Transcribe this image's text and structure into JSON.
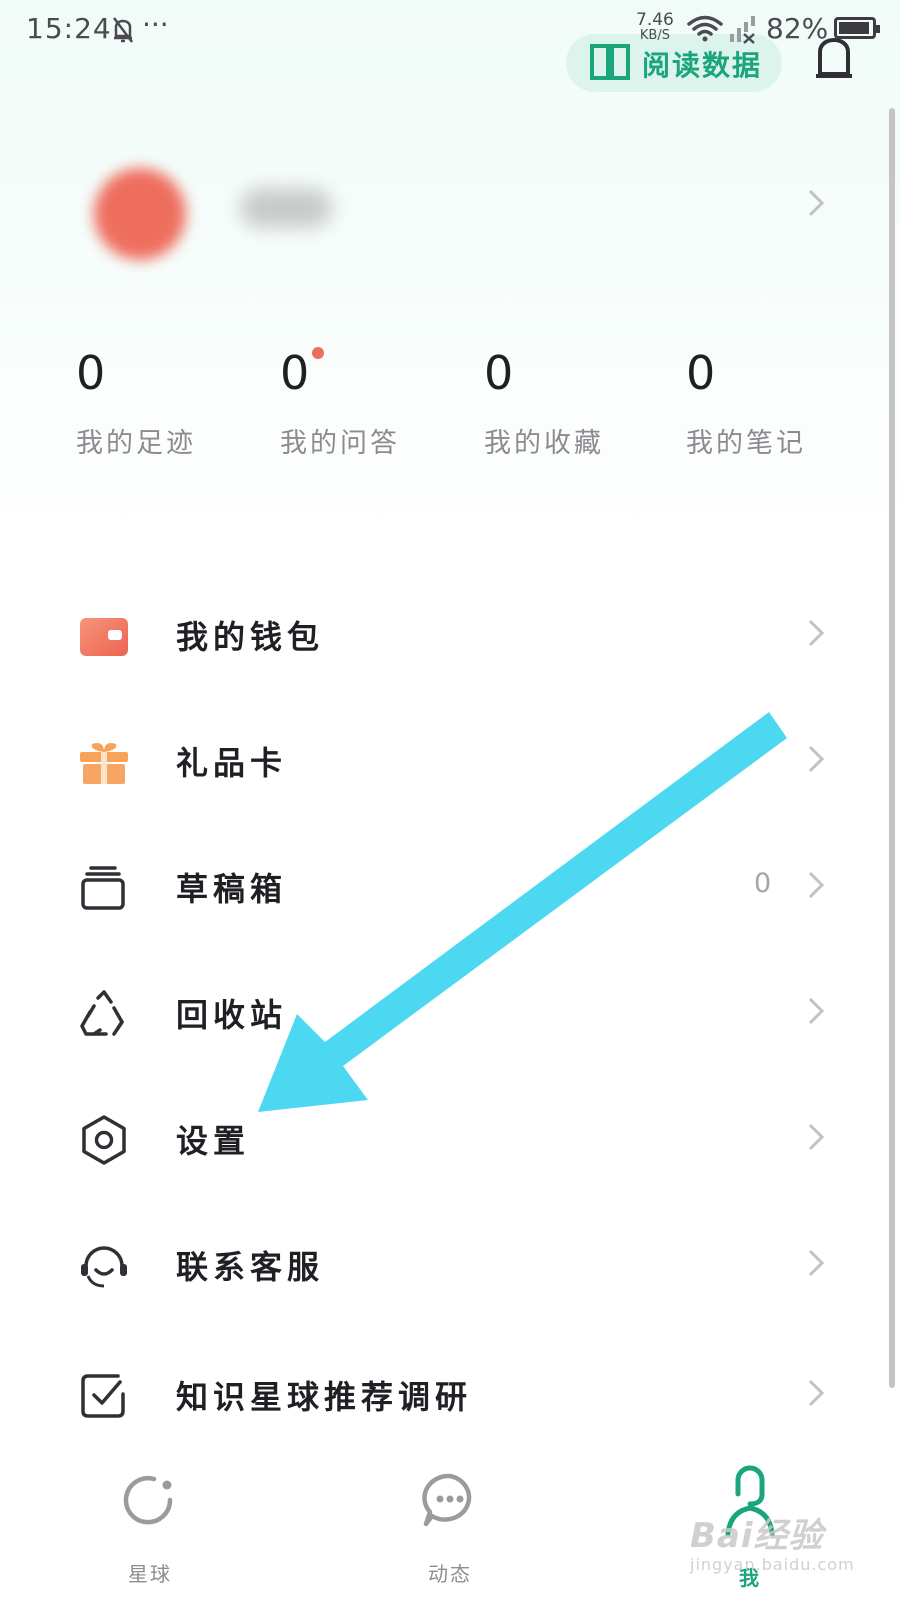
{
  "status_bar": {
    "time": "15:24",
    "more": "···",
    "net_speed_value": "7.46",
    "net_speed_unit": "KB/S",
    "battery": "82%"
  },
  "header": {
    "read_data_label": "阅读数据",
    "icons": [
      "book-icon",
      "bell-icon"
    ]
  },
  "stats": [
    {
      "value": "0",
      "label": "我的足迹"
    },
    {
      "value": "0",
      "label": "我的问答"
    },
    {
      "value": "0",
      "label": "我的收藏"
    },
    {
      "value": "0",
      "label": "我的笔记"
    }
  ],
  "menu": [
    {
      "icon": "wallet-icon",
      "label": "我的钱包"
    },
    {
      "icon": "gift-icon",
      "label": "礼品卡"
    },
    {
      "icon": "drafts-icon",
      "label": "草稿箱",
      "count": "0"
    },
    {
      "icon": "recycle-icon",
      "label": "回收站"
    },
    {
      "icon": "settings-hexagon-icon",
      "label": "设置"
    },
    {
      "icon": "headset-icon",
      "label": "联系客服"
    },
    {
      "icon": "checkbox-icon",
      "label": "知识星球推荐调研"
    }
  ],
  "bottom_nav": [
    {
      "icon": "planet-icon",
      "label": "星球"
    },
    {
      "icon": "chat-bubble-icon",
      "label": "动态"
    },
    {
      "icon": "person-icon",
      "label": "我",
      "active": true
    }
  ],
  "watermark": {
    "brand": "Bai经验",
    "url": "jingyan.baidu.com"
  },
  "colors": {
    "accent": "#1aa57c",
    "dot": "#ee6e5e",
    "annotation_arrow": "#4dd8f2"
  }
}
